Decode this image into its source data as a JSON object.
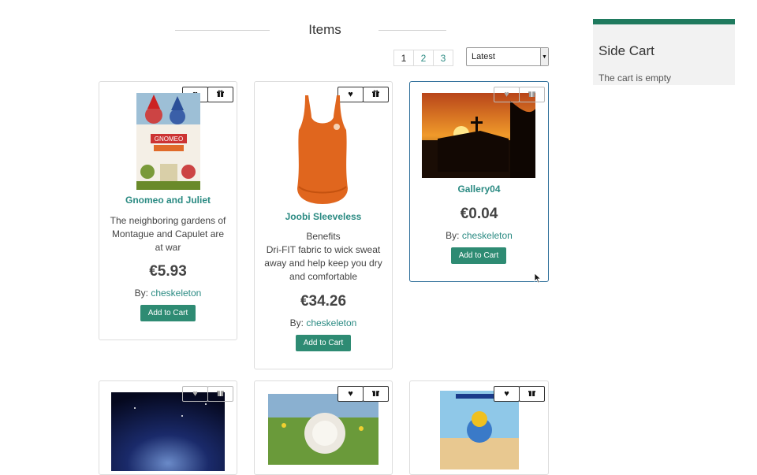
{
  "header": {
    "title": "Items"
  },
  "pagination": {
    "pages": [
      "1",
      "2",
      "3"
    ],
    "active": "1"
  },
  "sort": {
    "selected": "Latest"
  },
  "products": [
    {
      "name": "Gnomeo and Juliet",
      "description": "The neighboring gardens of Montague and Capulet are at war",
      "price": "€5.93",
      "by_label": "By:",
      "author": "cheskeleton",
      "add_label": "Add to Cart"
    },
    {
      "name": "Joobi Sleeveless",
      "description_lines": [
        "Benefits",
        "Dri-FIT fabric to wick sweat away and help keep you dry and comfortable"
      ],
      "price": "€34.26",
      "by_label": "By:",
      "author": "cheskeleton",
      "add_label": "Add to Cart"
    },
    {
      "name": "Gallery04",
      "price": "€0.04",
      "by_label": "By:",
      "author": "cheskeleton",
      "add_label": "Add to Cart"
    }
  ],
  "side_cart": {
    "title": "Side Cart",
    "empty_text": "The cart is empty"
  },
  "icons": {
    "wishlist": "heart-icon",
    "gift": "gift-icon"
  },
  "colors": {
    "accent": "#2a8a82",
    "button": "#2e8b73",
    "cart_bar": "#1f7a5e"
  }
}
